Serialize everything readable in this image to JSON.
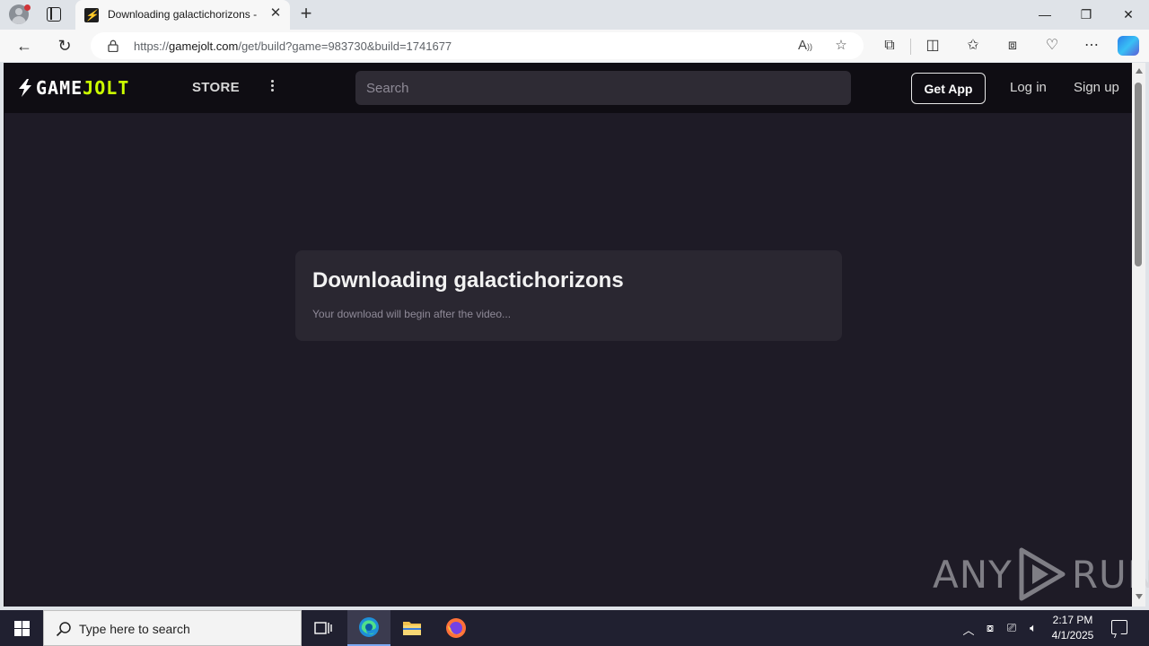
{
  "browser": {
    "tab_title": "Downloading galactichorizons - Game Jolt",
    "new_tab_label": "+",
    "url_prefix": "https://",
    "url_host": "gamejolt.com",
    "url_path": "/get/build?game=983730&build=1741677",
    "window_controls": [
      "minimize",
      "restore",
      "close"
    ]
  },
  "gamejolt": {
    "logo_game": "GAME",
    "logo_jolt": "JOLT",
    "store_label": "STORE",
    "search_placeholder": "Search",
    "get_app_label": "Get App",
    "login_label": "Log in",
    "signup_label": "Sign up"
  },
  "download": {
    "title": "Downloading galactichorizons",
    "subtitle": "Your download will begin after the video..."
  },
  "watermark": {
    "left": "ANY",
    "right": "RUN"
  },
  "taskbar": {
    "search_placeholder": "Type here to search",
    "time": "2:17 PM",
    "date": "4/1/2025"
  },
  "colors": {
    "page_bg": "#1e1b26",
    "header_bg": "#0f0d13",
    "card_bg": "#2a2731",
    "accent": "#ccff00"
  }
}
